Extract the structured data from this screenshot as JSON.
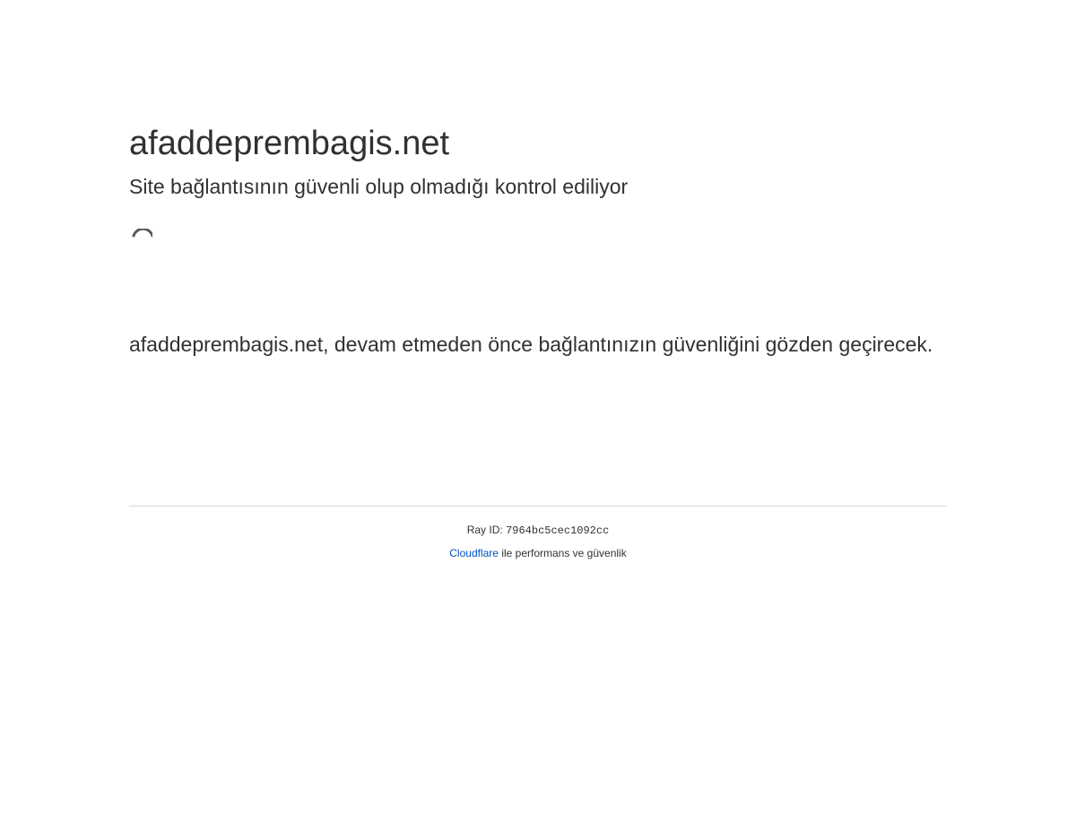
{
  "header": {
    "site_name": "afaddeprembagis.net",
    "subtitle": "Site bağlantısının güvenli olup olmadığı kontrol ediliyor"
  },
  "spinner": {
    "icon": "loading-spinner-icon",
    "color": "#595959"
  },
  "main": {
    "message": "afaddeprembagis.net, devam etmeden önce bağlantınızın güvenliğini gözden geçirecek."
  },
  "footer": {
    "ray_label": "Ray ID:",
    "ray_id": "7964bc5cec1092cc",
    "provider_link": "Cloudflare",
    "provider_suffix": "ile performans ve güvenlik",
    "link_color": "#0051c3",
    "divider_color": "#d9d9d9"
  }
}
